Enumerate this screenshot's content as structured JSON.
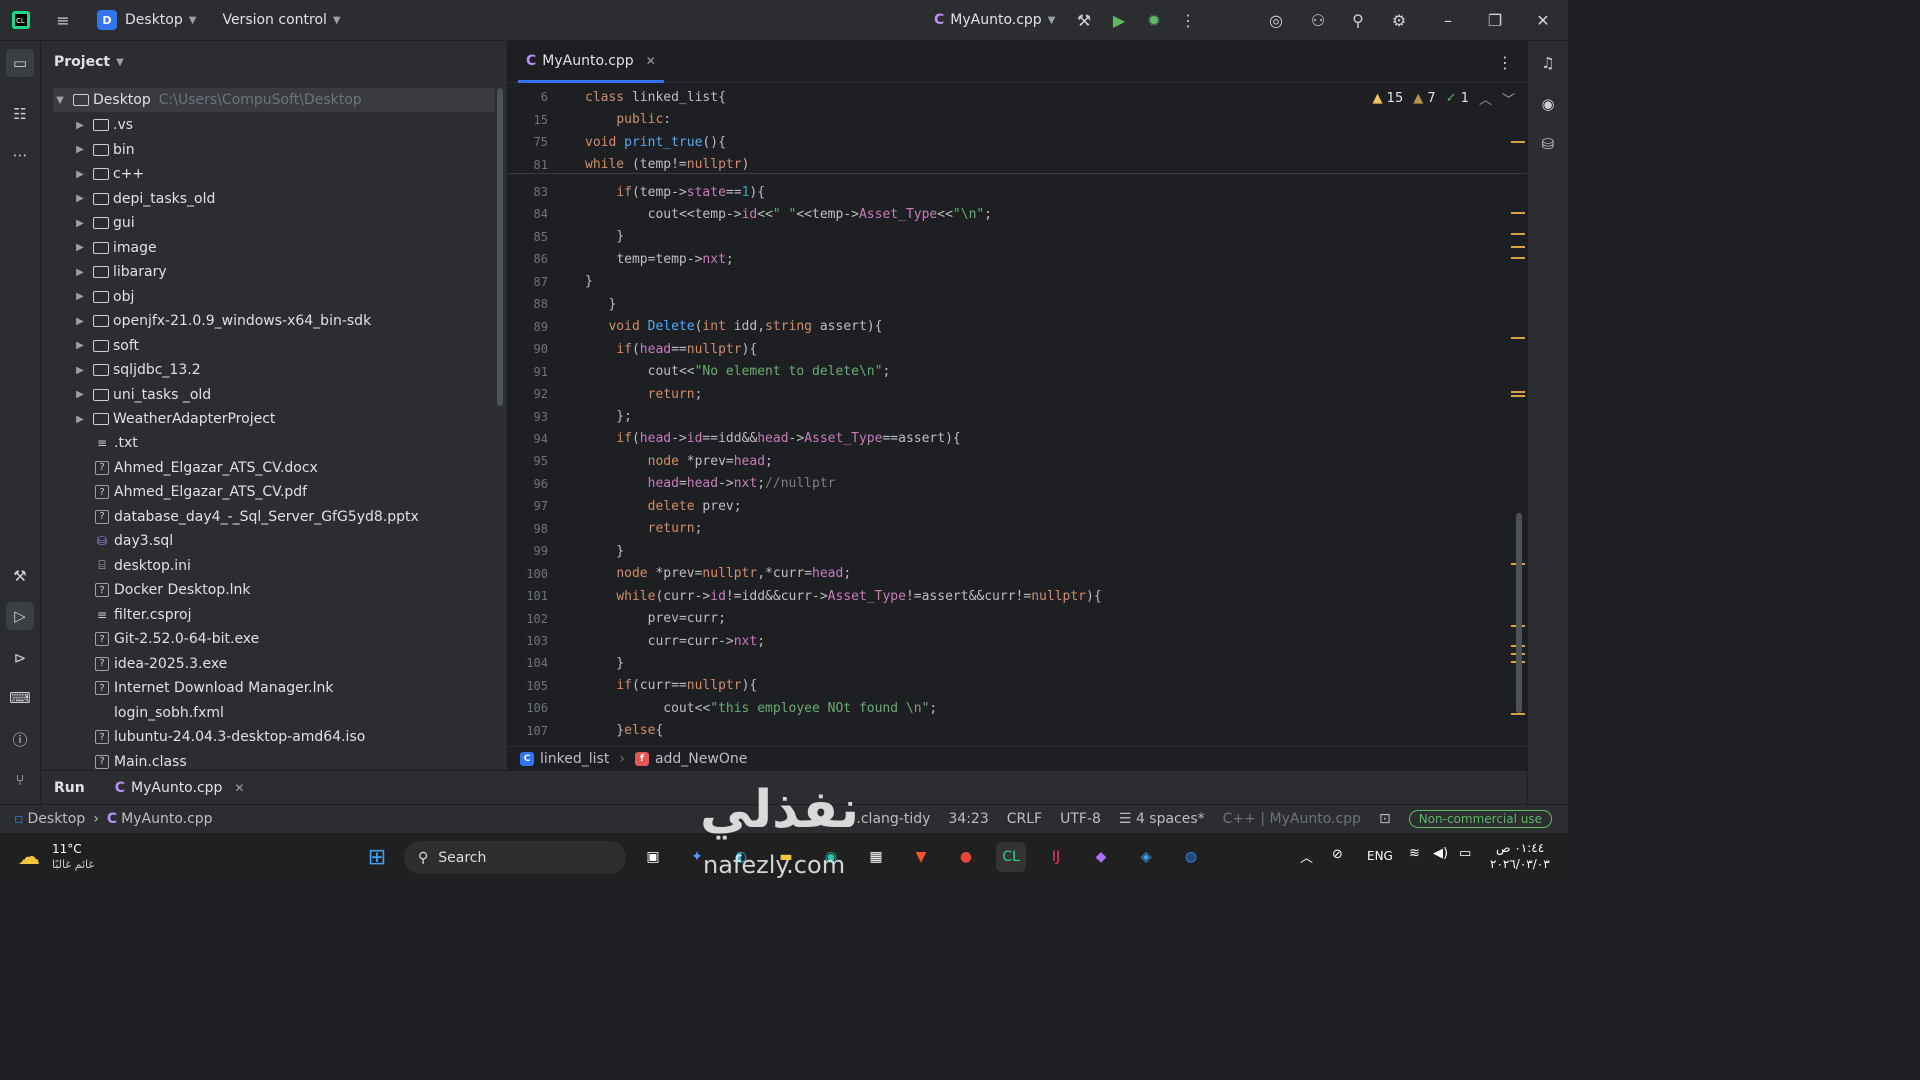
{
  "topbar": {
    "project_badge": "D",
    "project_name": "Desktop",
    "vcs": "Version control",
    "run_config": "MyAunto.cpp"
  },
  "project_panel": {
    "title": "Project",
    "root": {
      "name": "Desktop",
      "path": "C:\\Users\\CompuSoft\\Desktop"
    },
    "folders": [
      ".vs",
      "bin",
      "c++",
      "depi_tasks_old",
      "gui",
      "image",
      "libarary",
      "obj",
      "openjfx-21.0.9_windows-x64_bin-sdk",
      "soft",
      "sqljdbc_13.2",
      "uni_tasks _old",
      "WeatherAdapterProject"
    ],
    "files": [
      {
        "name": ".txt",
        "icon": "text-file-icon"
      },
      {
        "name": "Ahmed_Elgazar_ATS_CV.docx",
        "icon": "unknown-file-icon"
      },
      {
        "name": "Ahmed_Elgazar_ATS_CV.pdf",
        "icon": "unknown-file-icon"
      },
      {
        "name": "database_day4_-_Sql_Server_GfG5yd8.pptx",
        "icon": "unknown-file-icon"
      },
      {
        "name": "day3.sql",
        "icon": "database-file-icon"
      },
      {
        "name": "desktop.ini",
        "icon": "config-file-icon"
      },
      {
        "name": "Docker Desktop.lnk",
        "icon": "unknown-file-icon"
      },
      {
        "name": "filter.csproj",
        "icon": "text-file-icon"
      },
      {
        "name": "Git-2.52.0-64-bit.exe",
        "icon": "unknown-file-icon"
      },
      {
        "name": "idea-2025.3.exe",
        "icon": "unknown-file-icon"
      },
      {
        "name": "Internet Download Manager.lnk",
        "icon": "unknown-file-icon"
      },
      {
        "name": "login_sobh.fxml",
        "icon": "xml-file-icon"
      },
      {
        "name": "lubuntu-24.04.3-desktop-amd64.iso",
        "icon": "unknown-file-icon"
      },
      {
        "name": "Main.class",
        "icon": "unknown-file-icon"
      }
    ]
  },
  "editor": {
    "tab_label": "MyAunto.cpp",
    "inspections": {
      "warnings": "15",
      "weak_warnings": "7",
      "typos": "1"
    },
    "lines": [
      {
        "n": "6",
        "code": "class linked_list{"
      },
      {
        "n": "15",
        "code": "    public:"
      },
      {
        "n": "75",
        "code": "void print_true(){"
      },
      {
        "n": "81",
        "code": "while (temp!=nullptr)"
      },
      {
        "n": "83",
        "code": "    if(temp->state==1){"
      },
      {
        "n": "84",
        "code": "        cout<<temp->id<<\" \"<<temp->Asset_Type<<\"\\n\";"
      },
      {
        "n": "85",
        "code": "    }"
      },
      {
        "n": "86",
        "code": "    temp=temp->nxt;"
      },
      {
        "n": "87",
        "code": "}"
      },
      {
        "n": "88",
        "code": "   }"
      },
      {
        "n": "89",
        "code": "   void Delete(int idd,string assert){"
      },
      {
        "n": "90",
        "code": "    if(head==nullptr){"
      },
      {
        "n": "91",
        "code": "        cout<<\"No element to delete\\n\";"
      },
      {
        "n": "92",
        "code": "        return;"
      },
      {
        "n": "93",
        "code": "    };"
      },
      {
        "n": "94",
        "code": "    if(head->id==idd&&head->Asset_Type==assert){"
      },
      {
        "n": "95",
        "code": "        node *prev=head;"
      },
      {
        "n": "96",
        "code": "        head=head->nxt;//nullptr"
      },
      {
        "n": "97",
        "code": "        delete prev;"
      },
      {
        "n": "98",
        "code": "        return;"
      },
      {
        "n": "99",
        "code": "    }"
      },
      {
        "n": "100",
        "code": "    node *prev=nullptr,*curr=head;"
      },
      {
        "n": "101",
        "code": "    while(curr->id!=idd&&curr->Asset_Type!=assert&&curr!=nullptr){"
      },
      {
        "n": "102",
        "code": "        prev=curr;"
      },
      {
        "n": "103",
        "code": "        curr=curr->nxt;"
      },
      {
        "n": "104",
        "code": "    }"
      },
      {
        "n": "105",
        "code": "    if(curr==nullptr){"
      },
      {
        "n": "106",
        "code": "          cout<<\"this employee NOt found \\n\";"
      },
      {
        "n": "107",
        "code": "    }else{"
      }
    ],
    "breadcrumb": {
      "class": "linked_list",
      "method": "add_NewOne"
    }
  },
  "run_panel": {
    "label": "Run",
    "tab": "MyAunto.cpp"
  },
  "statusbar": {
    "crumb_root": "Desktop",
    "crumb_file": "MyAunto.cpp",
    "lint": ".clang-tidy",
    "position": "34:23",
    "line_sep": "CRLF",
    "encoding": "UTF-8",
    "indent": "4 spaces*",
    "lang": "C++ | MyAunto.cpp",
    "license": "Non-commercial use"
  },
  "taskbar": {
    "temp": "11°C",
    "weather": "غائم غالبًا",
    "search": "Search",
    "lang": "ENG",
    "time": "٠١:٤٤ ص",
    "date": "٢٠٢٦/٠٣/٠٣"
  },
  "watermark": {
    "arabic": "نفذلي",
    "latin": "nafezly.com"
  },
  "colors": {
    "accent": "#3574f0",
    "warning": "#f2c55c",
    "ok": "#5fb865"
  }
}
